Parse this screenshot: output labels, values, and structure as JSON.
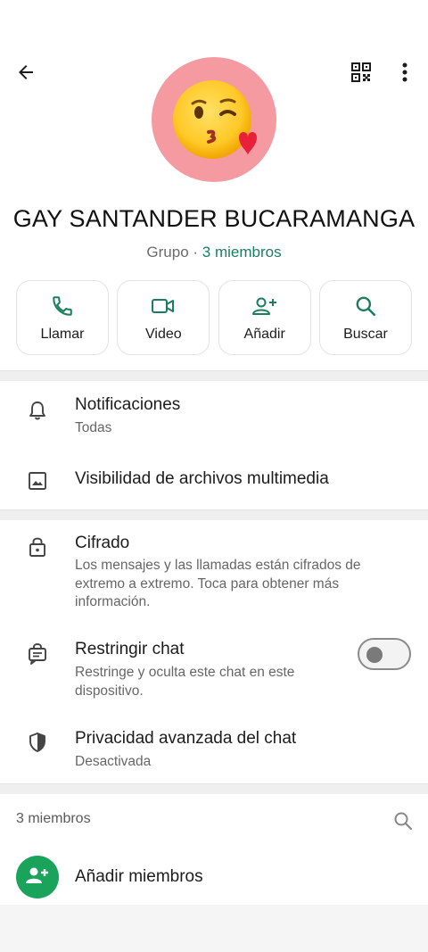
{
  "header": {
    "back_icon": "arrow-left-icon",
    "qr_icon": "qr-code-icon",
    "menu_icon": "more-vertical-icon"
  },
  "profile": {
    "avatar_emoji": "😘",
    "avatar_bg": "#f49aa0",
    "name": "GAY SANTANDER BUCARAMANGA",
    "type_label": "Grupo",
    "dot": " · ",
    "members_label": "3 miembros"
  },
  "actions": [
    {
      "label": "Llamar",
      "icon": "phone-icon"
    },
    {
      "label": "Video",
      "icon": "video-icon"
    },
    {
      "label": "Añadir",
      "icon": "add-person-icon"
    },
    {
      "label": "Buscar",
      "icon": "search-icon"
    }
  ],
  "settings": {
    "notifications": {
      "title": "Notificaciones",
      "desc": "Todas"
    },
    "media": {
      "title": "Visibilidad de archivos multimedia"
    },
    "encryption": {
      "title": "Cifrado",
      "desc": "Los mensajes y las llamadas están cifrados de extremo a extremo. Toca para obtener más información."
    },
    "restrict": {
      "title": "Restringir chat",
      "desc": "Restringe y oculta este chat en este dispositivo.",
      "enabled": false
    },
    "privacy": {
      "title": "Privacidad avanzada del chat",
      "desc": "Desactivada"
    }
  },
  "members": {
    "header": "3 miembros",
    "add_label": "Añadir miembros"
  },
  "colors": {
    "accent": "#1a7f5a",
    "icon_green": "#1aa35a"
  }
}
